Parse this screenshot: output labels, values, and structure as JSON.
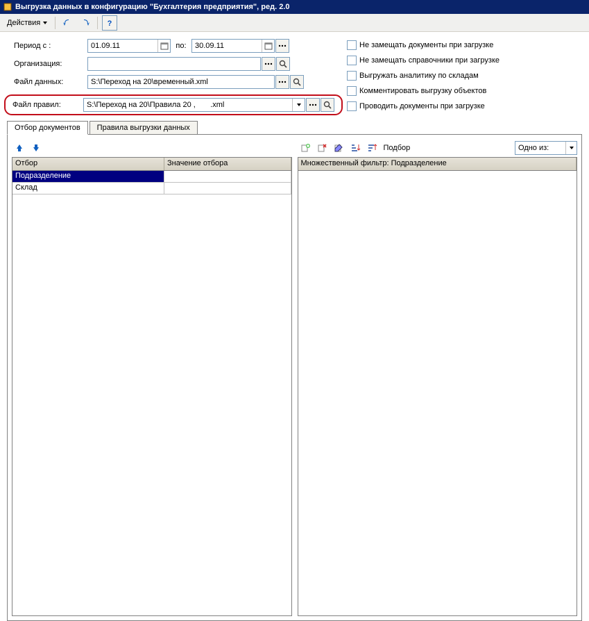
{
  "window": {
    "title": "Выгрузка данных в конфигурацию \"Бухгалтерия предприятия\", ред.  2.0"
  },
  "toolbar": {
    "actions_label": "Действия"
  },
  "form": {
    "period_label": "Период с :",
    "period_from": "01.09.11",
    "period_to_label": "по:",
    "period_to": "30.09.11",
    "org_label": "Организация:",
    "org_value": "",
    "datafile_label": "Файл данных:",
    "datafile_value": "S:\\Переход на 20\\временный.xml",
    "rulesfile_label": "Файл правил:",
    "rulesfile_value": "S:\\Переход на 20\\Правила 20 ,       .xml"
  },
  "options": {
    "no_replace_docs": "Не замещать документы при загрузке",
    "no_replace_refs": "Не замещать справочники при загрузке",
    "upload_warehouse": "Выгружать аналитику по складам",
    "comment_upload": "Комментировать выгрузку объектов",
    "post_docs": "Проводить документы при загрузке"
  },
  "tabs": {
    "t1": "Отбор документов",
    "t2": "Правила выгрузки данных"
  },
  "left_grid": {
    "col1": "Отбор",
    "col2": "Значение отбора",
    "rows": [
      {
        "c1": "Подразделение",
        "c2": ""
      },
      {
        "c1": "Склад",
        "c2": ""
      }
    ]
  },
  "right_panel": {
    "podbor_label": "Подбор",
    "combo_value": "Одно из:",
    "filter_header": "Множественный фильтр: Подразделение"
  }
}
